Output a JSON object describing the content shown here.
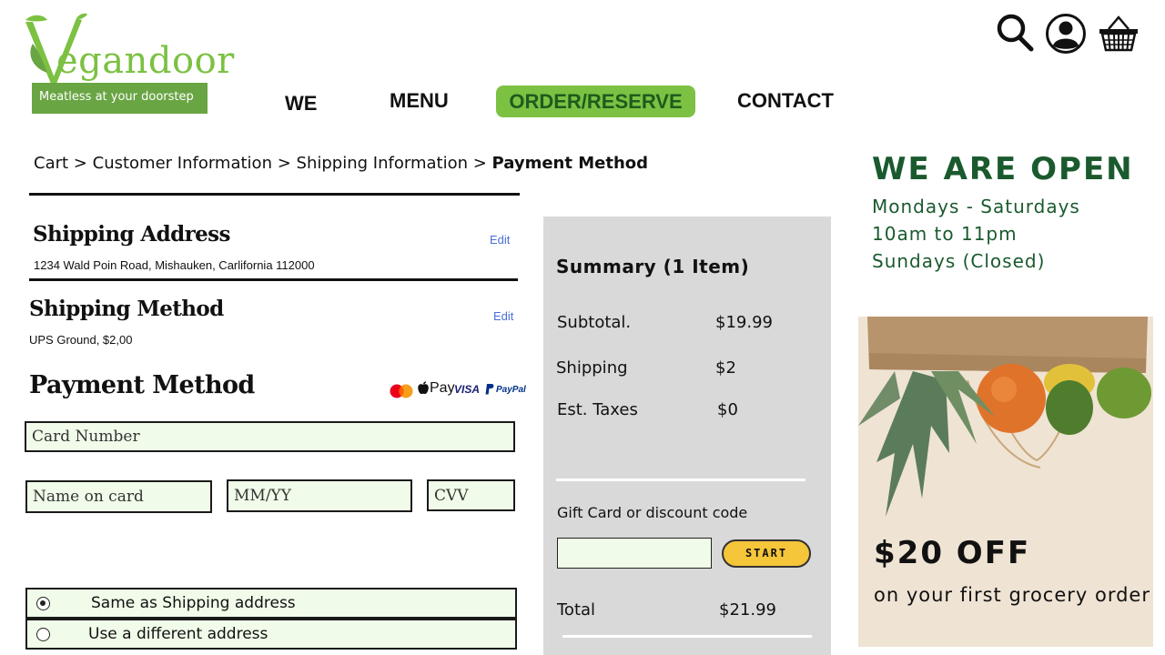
{
  "brand": {
    "name": "egandoor",
    "tagline": "Meatless at your doorstep",
    "colors": {
      "green": "#7cc142",
      "dark_green": "#1a5a2e",
      "tag_green": "#6aa544"
    }
  },
  "header_icons": [
    "search-icon",
    "user-icon",
    "basket-icon"
  ],
  "nav": {
    "we": "WE",
    "menu": "MENU",
    "order": "ORDER/RESERVE",
    "contact": "CONTACT"
  },
  "breadcrumb": {
    "cart": "Cart",
    "customer": "Customer Information",
    "shipping": "Shipping Information",
    "payment": "Payment Method",
    "separator": ">"
  },
  "shipping_address": {
    "title": "Shipping Address",
    "value": "1234 Wald Poin Road, Mishauken, Carlifornia 112000",
    "edit": "Edit"
  },
  "shipping_method": {
    "title": "Shipping Method",
    "value": "UPS Ground, $2,00",
    "edit": "Edit"
  },
  "payment": {
    "title": "Payment Method",
    "providers": {
      "mastercard": "mastercard",
      "applepay": "Pay",
      "visa": "VISA",
      "paypal": "PayPal"
    },
    "card_number_placeholder": "Card Number",
    "name_placeholder": "Name on card",
    "expiry_placeholder": "MM/YY",
    "cvv_placeholder": "CVV",
    "same_address": "Same as Shipping address",
    "different_address": "Use a different address",
    "selected_option": "same"
  },
  "summary": {
    "title": "Summary (1 Item)",
    "subtotal_label": "Subtotal.",
    "subtotal_value": "$19.99",
    "shipping_label": "Shipping",
    "shipping_value": "$2",
    "taxes_label": "Est. Taxes",
    "taxes_value": "$0",
    "gift_label": "Gift Card or discount code",
    "start_label": "START",
    "total_label": "Total",
    "total_value": "$21.99"
  },
  "hours": {
    "title": "WE ARE OPEN",
    "line1": "Mondays - Saturdays",
    "line2": "10am to 11pm",
    "line3": "Sundays (Closed)"
  },
  "promo": {
    "headline": "$20 OFF",
    "subline": "on your first grocery order"
  }
}
